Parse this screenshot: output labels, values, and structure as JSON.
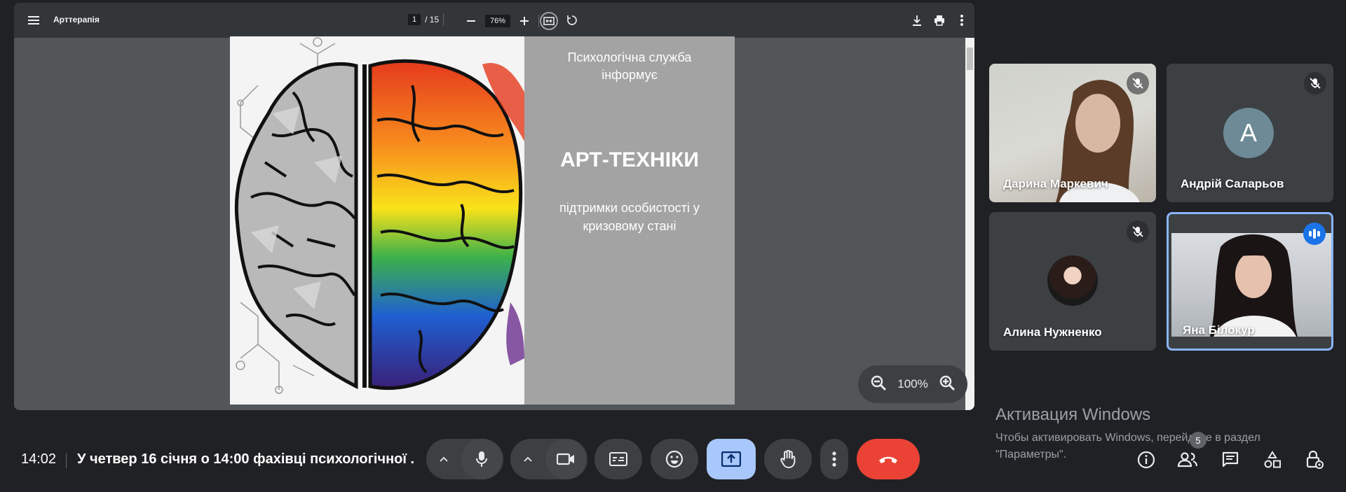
{
  "pdf_viewer": {
    "doc_title": "Арттерапія",
    "current_page": "1",
    "page_total": "/ 15",
    "zoom": "76%",
    "floating_zoom": "100%"
  },
  "slide": {
    "top_text_line1": "Психологічна служба",
    "top_text_line2": "інформує",
    "title": "АРТ-ТЕХНІКИ",
    "subtitle_line1": "підтримки особистості у",
    "subtitle_line2": "кризовому стані"
  },
  "participants": [
    {
      "name": "Дарина Маркевич",
      "muted": true
    },
    {
      "name": "Андрій Саларьов",
      "muted": true,
      "initial": "A"
    },
    {
      "name": "Алина Нужненко",
      "muted": true
    },
    {
      "name": "Яна Білокур",
      "speaking": true
    }
  ],
  "watermark": {
    "title": "Активация Windows",
    "line1": "Чтобы активировать Windows, перейдите в раздел",
    "line2": "\"Параметры\"."
  },
  "bottom_bar": {
    "time": "14:02",
    "meeting_title": "У четвер 16 січня о 14:00 фахівці психологічної ...",
    "people_count": "5"
  },
  "colors": {
    "background": "#202124",
    "leave": "#ea4335",
    "present_active": "#a8c7fa",
    "speaking": "#1a73e8",
    "active_tile_border": "#8ab4f8"
  }
}
